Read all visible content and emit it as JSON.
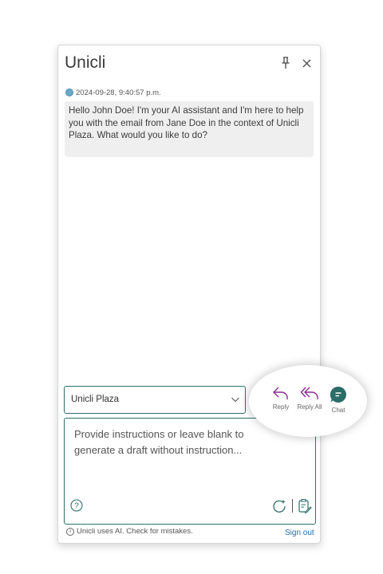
{
  "header": {
    "title": "Unicli"
  },
  "message": {
    "timestamp": "2024-09-28, 9:40:57 p.m.",
    "text": "Hello John Doe! I'm your AI assistant and I'm here to help you with the email from Jane Doe in the context of Unicli Plaza. What would you like to do?"
  },
  "context_select": {
    "value": "Unicli Plaza"
  },
  "compose": {
    "placeholder": "Provide instructions or leave blank to generate a draft without instruction..."
  },
  "footer": {
    "note": "Unicli uses AI. Check for mistakes.",
    "signout_label": "Sign out"
  },
  "actions": {
    "reply_label": "Reply",
    "reply_all_label": "Reply All",
    "chat_label": "Chat"
  },
  "colors": {
    "accent": "#2f6f6a",
    "action_purple": "#8a2a92",
    "chat_teal": "#2b6d68",
    "link": "#2b6cb0"
  }
}
